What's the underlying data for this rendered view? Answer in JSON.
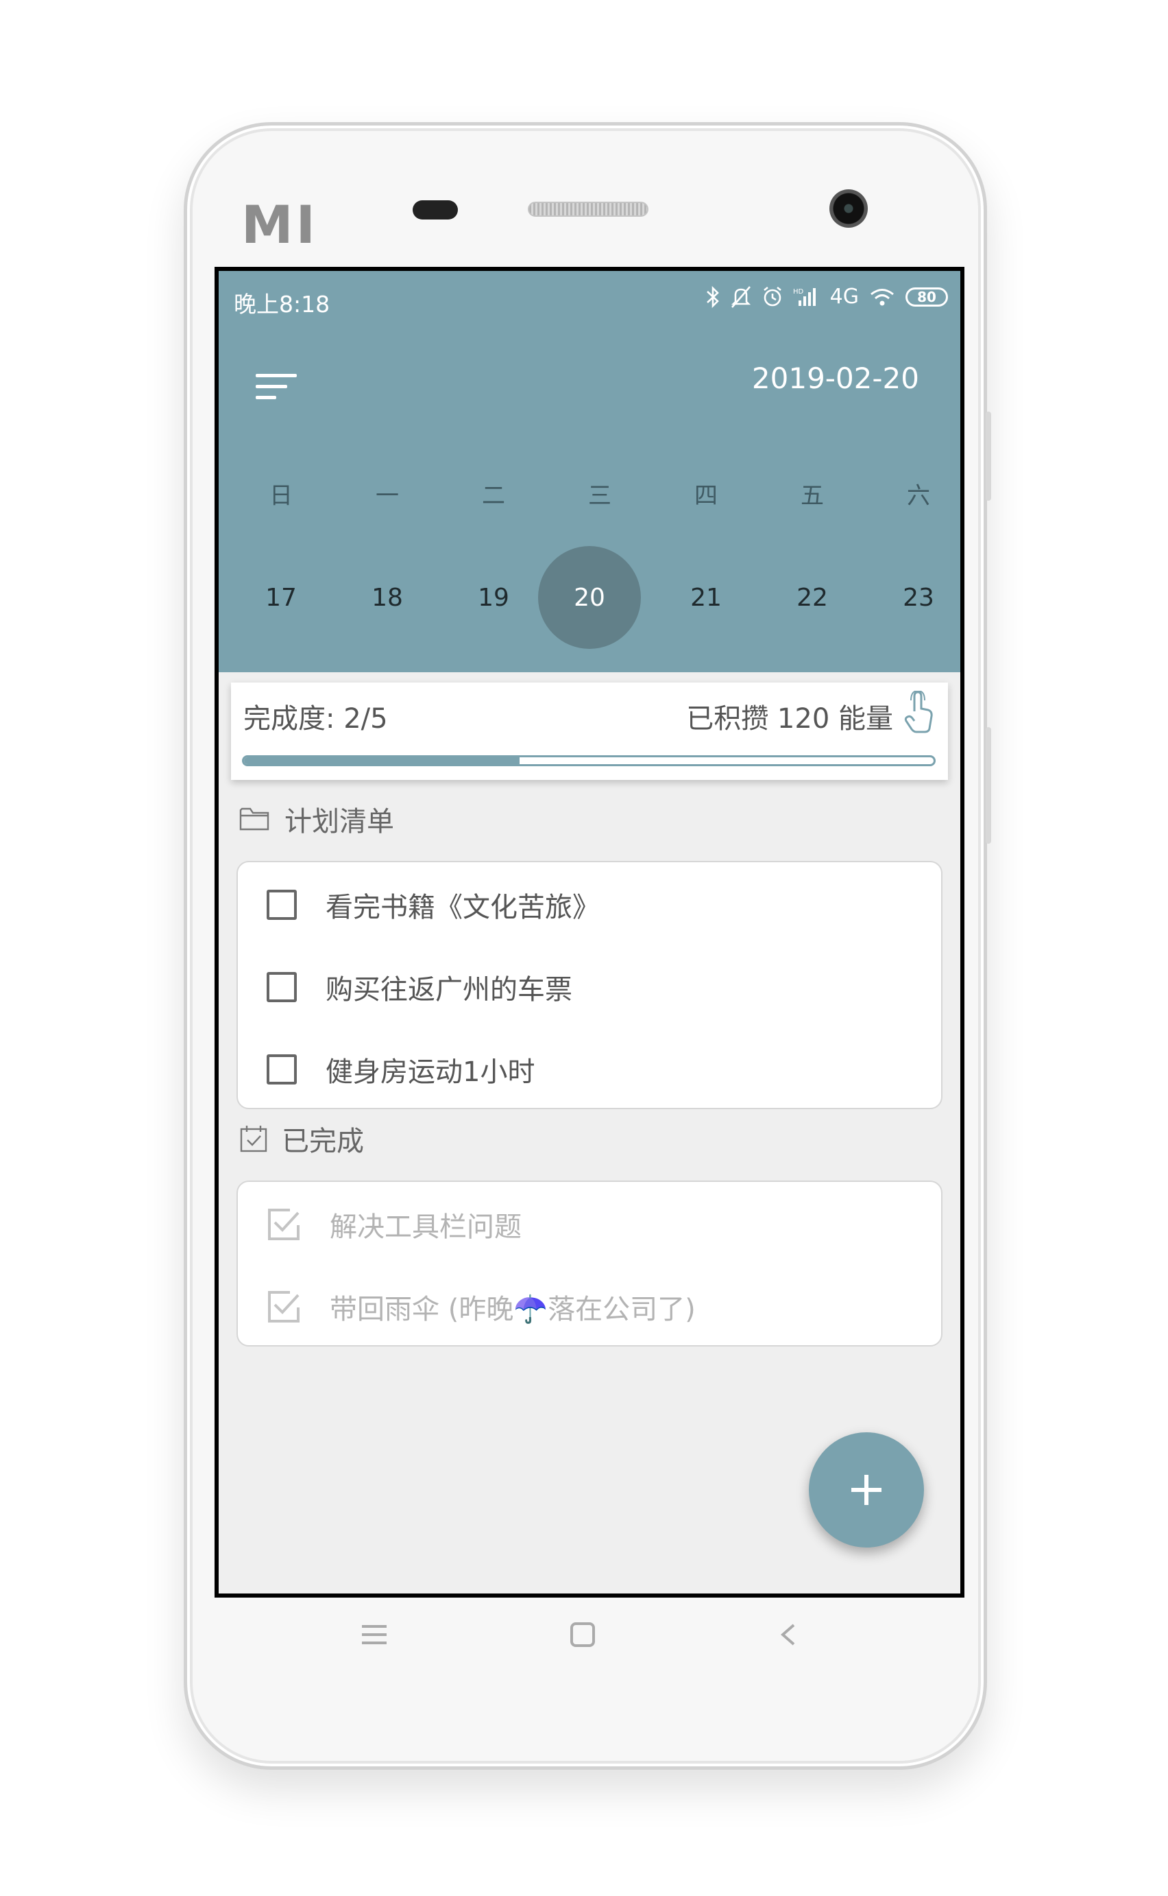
{
  "hardware": {
    "brand_logo": "MI"
  },
  "status_bar": {
    "time": "晚上8:18",
    "network": "4G",
    "battery": "80"
  },
  "header": {
    "menu_icon": "menu-icon",
    "date": "2019-02-20"
  },
  "calendar": {
    "weekdays": [
      "日",
      "一",
      "二",
      "三",
      "四",
      "五",
      "六"
    ],
    "days": [
      "17",
      "18",
      "19",
      "20",
      "21",
      "22",
      "23"
    ],
    "selected_day": "20"
  },
  "progress": {
    "label": "完成度: 2/5",
    "energy": "已积攒 120 能量",
    "completed": 2,
    "total": 5
  },
  "plan_section": {
    "title": "计划清单",
    "items": [
      {
        "text": "看完书籍《文化苦旅》"
      },
      {
        "text": "购买往返广州的车票"
      },
      {
        "text": "健身房运动1小时"
      }
    ]
  },
  "done_section": {
    "title": "已完成",
    "items": [
      {
        "text": "解决工具栏问题"
      },
      {
        "text": "带回雨伞 (昨晚☂️落在公司了)"
      }
    ]
  },
  "fab": {
    "icon": "plus-icon"
  },
  "colors": {
    "primary": "#7aa2ae",
    "selected_day": "#628089",
    "background": "#efefef"
  }
}
